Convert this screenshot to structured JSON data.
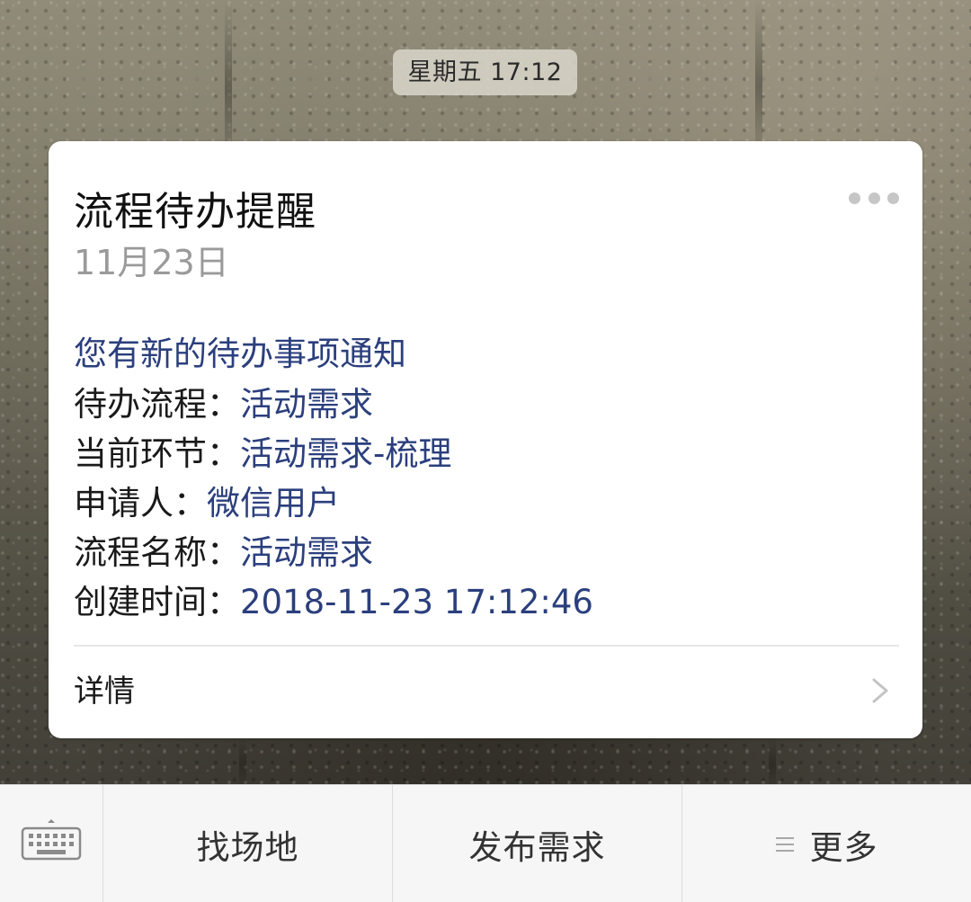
{
  "timestamp": "星期五 17:12",
  "card": {
    "title": "流程待办提醒",
    "date": "11月23日",
    "notice": "您有新的待办事项通知",
    "fields": [
      {
        "label": "待办流程：",
        "value": "活动需求"
      },
      {
        "label": "当前环节：",
        "value": "活动需求-梳理"
      },
      {
        "label": "申请人：",
        "value": "微信用户"
      },
      {
        "label": "流程名称：",
        "value": "活动需求"
      },
      {
        "label": "创建时间：",
        "value": "2018-11-23 17:12:46"
      }
    ],
    "detail_label": "详情"
  },
  "bottom_menu": {
    "items": [
      {
        "label": "找场地"
      },
      {
        "label": "发布需求"
      },
      {
        "label": "更多"
      }
    ]
  },
  "icons": {
    "keyboard": "keyboard-icon",
    "more": "more-dots-icon",
    "chevron": "chevron-right-icon",
    "menu": "menu-lines-icon"
  },
  "colors": {
    "link_blue": "#2b3f7d",
    "date_gray": "#9a9a9a",
    "card_bg": "#ffffff",
    "bar_bg": "#f6f6f6"
  }
}
